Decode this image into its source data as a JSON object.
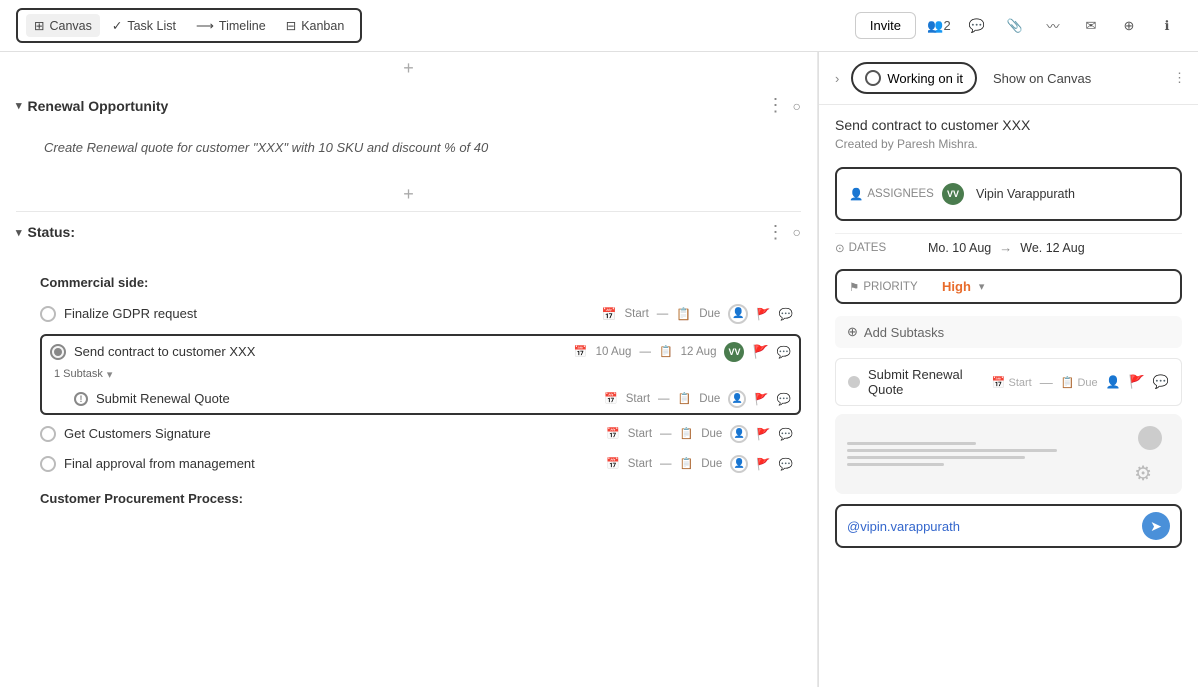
{
  "toolbar": {
    "canvas_label": "Canvas",
    "task_list_label": "Task List",
    "timeline_label": "Timeline",
    "kanban_label": "Kanban",
    "invite_label": "Invite",
    "member_count": "2"
  },
  "left": {
    "renewal_section": {
      "title": "Renewal Opportunity",
      "description": "Create Renewal quote for customer \"XXX\" with 10 SKU and discount % of 40"
    },
    "status_section": {
      "title": "Status:",
      "commercial_title": "Commercial side:",
      "tasks": [
        {
          "name": "Finalize GDPR request",
          "status": "open",
          "start": "Start",
          "due": "Due"
        },
        {
          "name": "Send contract to customer XXX",
          "status": "in_progress",
          "date_start": "10 Aug",
          "date_end": "12 Aug",
          "highlighted": true,
          "subtasks_label": "1 Subtask",
          "subtask": {
            "name": "Submit Renewal Quote",
            "start": "Start",
            "due": "Due"
          }
        },
        {
          "name": "Get Customers Signature",
          "status": "open",
          "start": "Start",
          "due": "Due"
        },
        {
          "name": "Final approval from management",
          "status": "open",
          "start": "Start",
          "due": "Due"
        }
      ],
      "customer_procurement_title": "Customer Procurement Process:"
    }
  },
  "right": {
    "working_on_label": "Working on it",
    "show_on_canvas_label": "Show on Canvas",
    "task_title": "Send contract to customer XXX",
    "created_by": "Created by Paresh Mishra.",
    "assignees_label": "ASSIGNEES",
    "assignee_initials": "VV",
    "assignee_name": "Vipin Varappurath",
    "dates_label": "DATES",
    "date_start": "Mo. 10 Aug",
    "date_end": "We. 12 Aug",
    "priority_label": "PRIORITY",
    "priority_value": "High",
    "add_subtasks_label": "Add Subtasks",
    "subtask_name": "Submit Renewal Quote",
    "mention_value": "@vipin.varappurath"
  }
}
